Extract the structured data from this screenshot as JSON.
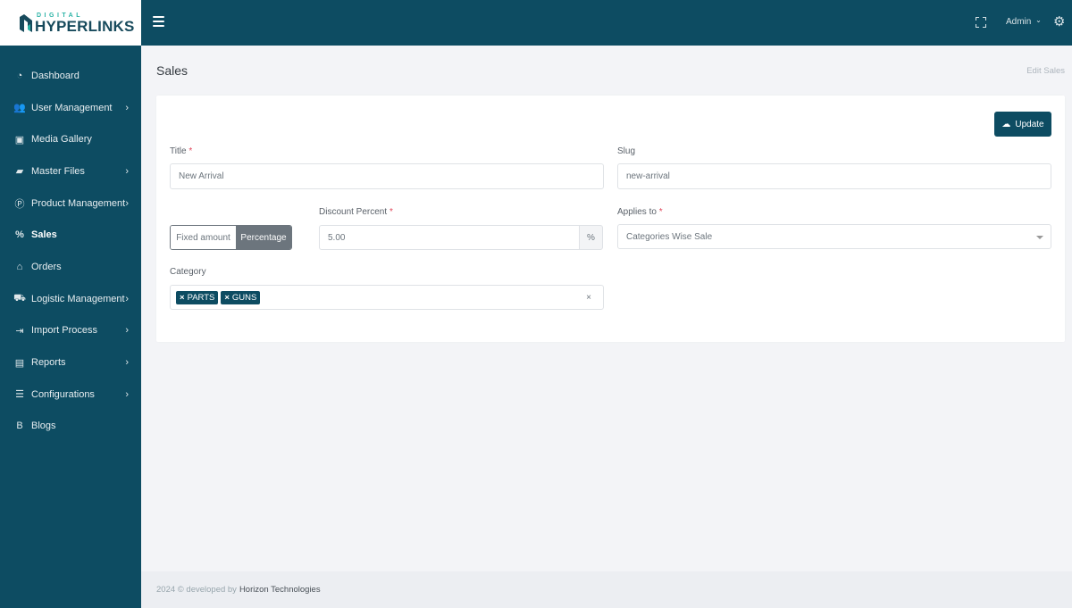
{
  "brand": {
    "small": "DIGITAL",
    "big": "HYPERLINKS"
  },
  "sidebar": {
    "items": [
      {
        "label": "Dashboard",
        "icon": "dashboard-icon",
        "glyph": "◔",
        "has_children": false,
        "active": false
      },
      {
        "label": "User Management",
        "icon": "users-icon",
        "glyph": "👥",
        "has_children": true,
        "active": false
      },
      {
        "label": "Media Gallery",
        "icon": "image-gallery-icon",
        "glyph": "▣",
        "has_children": false,
        "active": false
      },
      {
        "label": "Master Files",
        "icon": "folder-open-icon",
        "glyph": "▰",
        "has_children": true,
        "active": false
      },
      {
        "label": "Product Management",
        "icon": "product-p-icon",
        "glyph": "Ⓟ",
        "has_children": true,
        "active": false
      },
      {
        "label": "Sales",
        "icon": "percent-icon",
        "glyph": "%",
        "has_children": false,
        "active": true
      },
      {
        "label": "Orders",
        "icon": "basket-icon",
        "glyph": "⌂",
        "has_children": false,
        "active": false
      },
      {
        "label": "Logistic Management",
        "icon": "truck-icon",
        "glyph": "⛟",
        "has_children": true,
        "active": false
      },
      {
        "label": "Import Process",
        "icon": "file-import-icon",
        "glyph": "⇥",
        "has_children": true,
        "active": false
      },
      {
        "label": "Reports",
        "icon": "file-report-icon",
        "glyph": "▤",
        "has_children": true,
        "active": false
      },
      {
        "label": "Configurations",
        "icon": "list-config-icon",
        "glyph": "☰",
        "has_children": true,
        "active": false
      },
      {
        "label": "Blogs",
        "icon": "blog-icon",
        "glyph": "B",
        "has_children": false,
        "active": false
      }
    ],
    "chevron": "›"
  },
  "topbar": {
    "user": "Admin",
    "user_caret": "⌄",
    "gear_glyph": "⚙"
  },
  "page": {
    "title": "Sales",
    "breadcrumb": "Edit Sales"
  },
  "form": {
    "update_label": "Update",
    "update_glyph": "☁",
    "title_label": "Title",
    "title_value": "New Arrival",
    "slug_label": "Slug",
    "slug_value": "new-arrival",
    "required_mark": "*",
    "discount_type": {
      "options": [
        "Fixed amount",
        "Percentage"
      ],
      "selected": "Percentage"
    },
    "discount_label": "Discount Percent",
    "discount_value": "5.00",
    "discount_suffix": "%",
    "applies_label": "Applies to",
    "applies_value": "Categories Wise Sale",
    "category_label": "Category",
    "category_tags": [
      "PARTS",
      "GUNS"
    ],
    "tag_remove": "×",
    "clear_all": "×"
  },
  "footer": {
    "text": "2024 © developed by",
    "brand": "Horizon Technologies"
  },
  "colors": {
    "primary": "#0d4c62",
    "accent": "#2bb3a6",
    "required": "#e0475b",
    "secondary": "#6c757d"
  }
}
